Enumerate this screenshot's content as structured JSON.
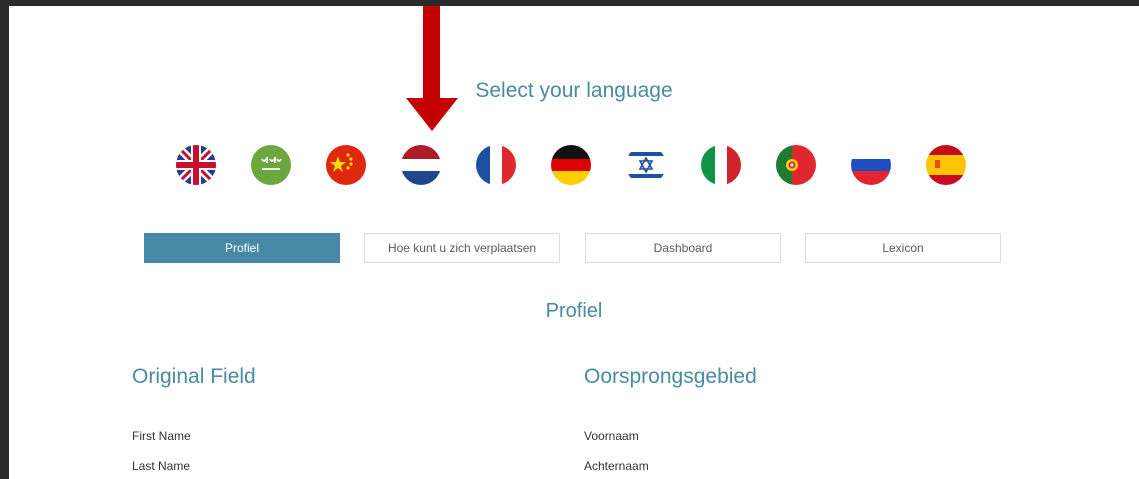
{
  "language_selector": {
    "title": "Select your language",
    "flags": [
      {
        "icon": "uk-flag-icon",
        "language": "English"
      },
      {
        "icon": "saudi-flag-icon",
        "language": "Arabic"
      },
      {
        "icon": "china-flag-icon",
        "language": "Chinese"
      },
      {
        "icon": "netherlands-flag-icon",
        "language": "Dutch"
      },
      {
        "icon": "france-flag-icon",
        "language": "French"
      },
      {
        "icon": "germany-flag-icon",
        "language": "German"
      },
      {
        "icon": "israel-flag-icon",
        "language": "Hebrew"
      },
      {
        "icon": "italy-flag-icon",
        "language": "Italian"
      },
      {
        "icon": "portugal-flag-icon",
        "language": "Portuguese"
      },
      {
        "icon": "russia-flag-icon",
        "language": "Russian"
      },
      {
        "icon": "spain-flag-icon",
        "language": "Spanish"
      }
    ],
    "selected_language": "Dutch"
  },
  "annotation": {
    "icon": "red-down-arrow-icon",
    "color": "#c00000"
  },
  "tabs": [
    {
      "label": "Profiel",
      "active": true
    },
    {
      "label": "Hoe kunt u zich verplaatsen",
      "active": false
    },
    {
      "label": "Dashboard",
      "active": false
    },
    {
      "label": "Lexicon",
      "active": false
    }
  ],
  "section": {
    "title": "Profiel"
  },
  "table": {
    "headers": [
      "Original Field",
      "Oorsprongsgebied"
    ],
    "rows": [
      [
        "First Name",
        "Voornaam"
      ],
      [
        "Last Name",
        "Achternaam"
      ]
    ]
  },
  "colors": {
    "accent": "#4789a4",
    "heading": "#4a8aa3",
    "arrow": "#c00000"
  }
}
